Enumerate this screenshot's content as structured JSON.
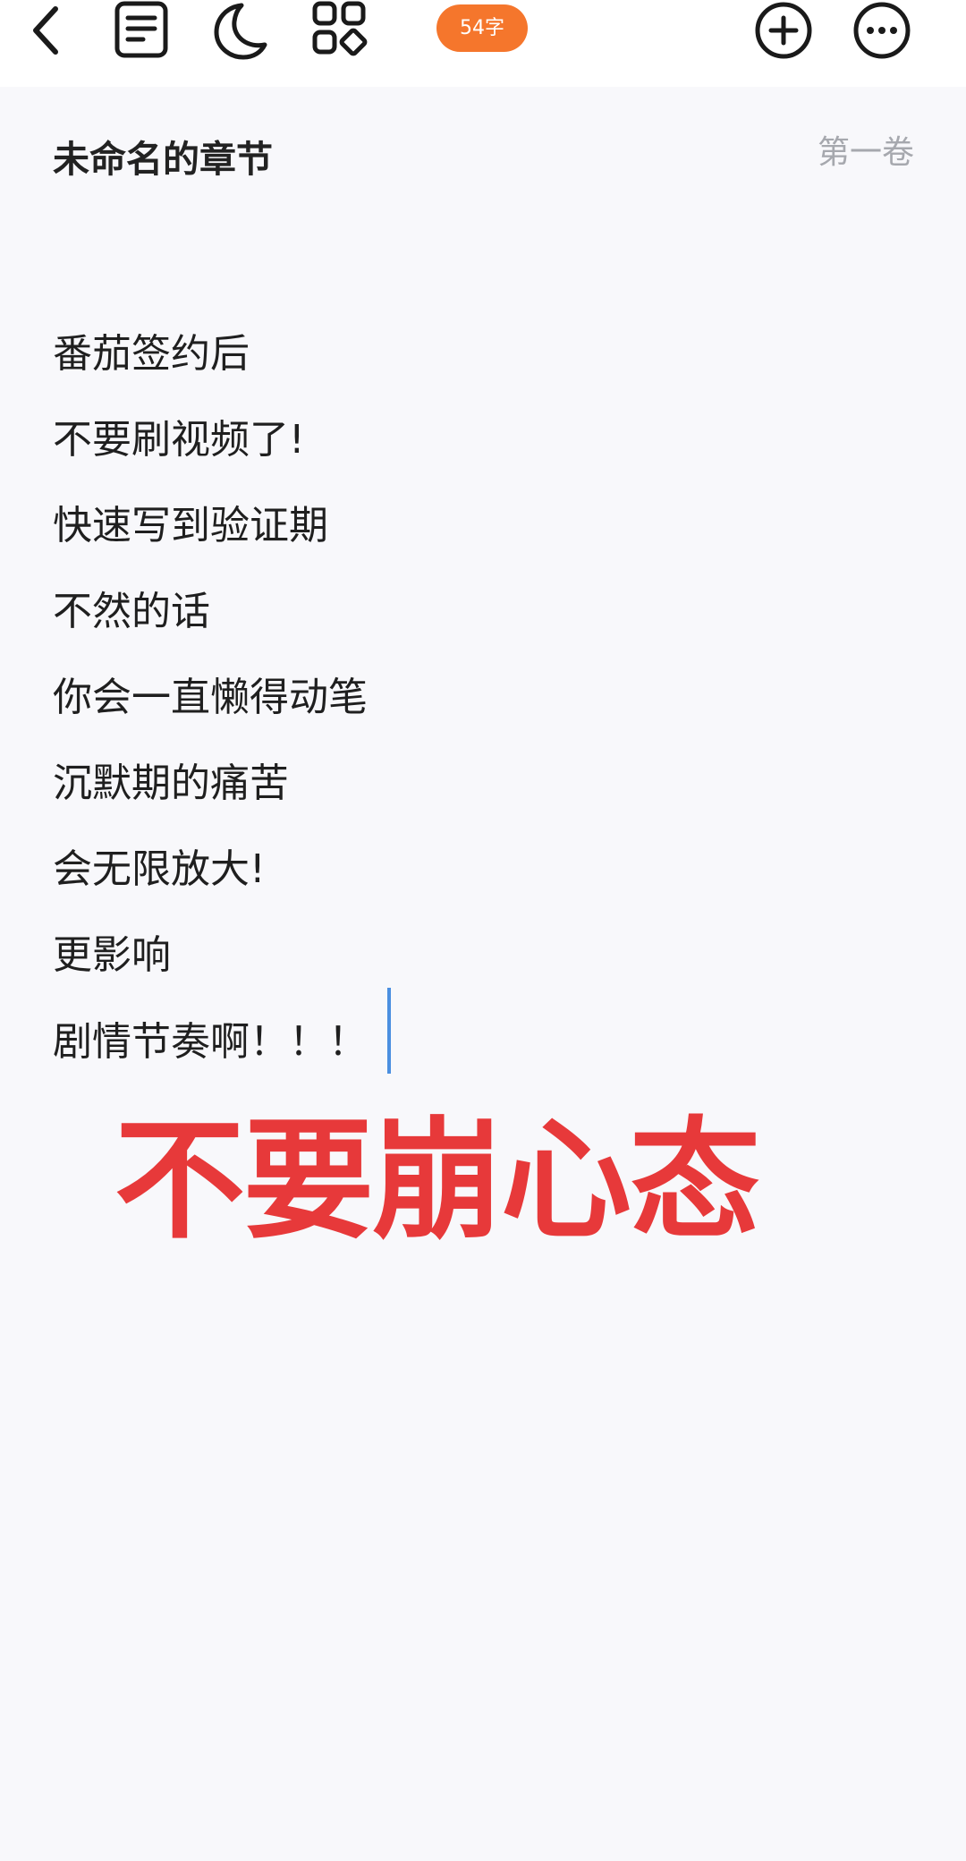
{
  "toolbar": {
    "back_icon": "chevron-left-icon",
    "outline_icon": "document-icon",
    "night_mode_icon": "moon-icon",
    "apps_icon": "grid-icon",
    "word_count": "54字",
    "add_icon": "plus-circle-icon",
    "more_icon": "ellipsis-circle-icon"
  },
  "chapter": {
    "title": "未命名的章节",
    "volume": "第一卷"
  },
  "body": {
    "lines": [
      "番茄签约后",
      "不要刷视频了!",
      "快速写到验证期",
      "不然的话",
      "你会一直懒得动笔",
      "沉默期的痛苦",
      "会无限放大!",
      "更影响",
      "剧情节奏啊！！！"
    ]
  },
  "overlay": {
    "caption": "不要崩心态"
  },
  "colors": {
    "accent": "#f5762c",
    "caption_red": "#e7393a",
    "caret_blue": "#4b8fe0",
    "background": "#f8f8fb"
  }
}
